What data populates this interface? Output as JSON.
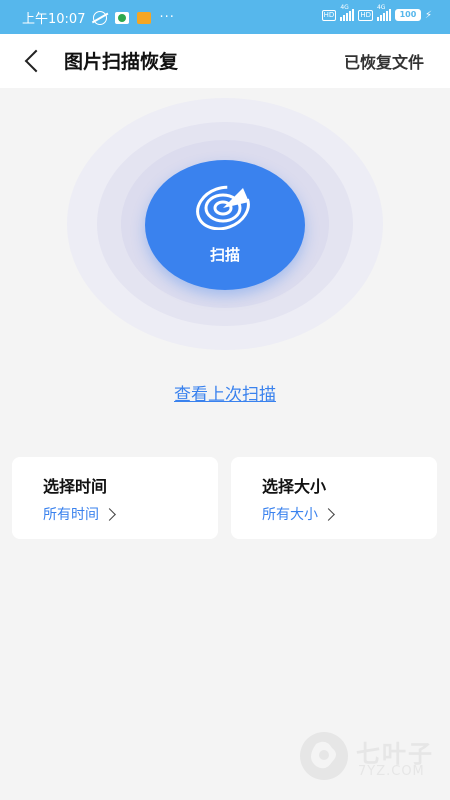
{
  "status_bar": {
    "time": "上午10:07",
    "dots": "···",
    "network_1": "HD",
    "network_type_1": "4G",
    "network_2": "HD",
    "network_type_2": "4G",
    "battery": "100"
  },
  "header": {
    "title": "图片扫描恢复",
    "restored_files": "已恢复文件"
  },
  "scan": {
    "button_label": "扫描",
    "last_scan_link": "查看上次扫描"
  },
  "filters": {
    "time": {
      "title": "选择时间",
      "value": "所有时间"
    },
    "size": {
      "title": "选择大小",
      "value": "所有大小"
    }
  },
  "watermark": {
    "text": "七叶子",
    "sub": "7YZ.COM"
  },
  "colors": {
    "accent": "#3a82ee",
    "status_bar": "#56b7ec",
    "background": "#f4f4f4"
  }
}
